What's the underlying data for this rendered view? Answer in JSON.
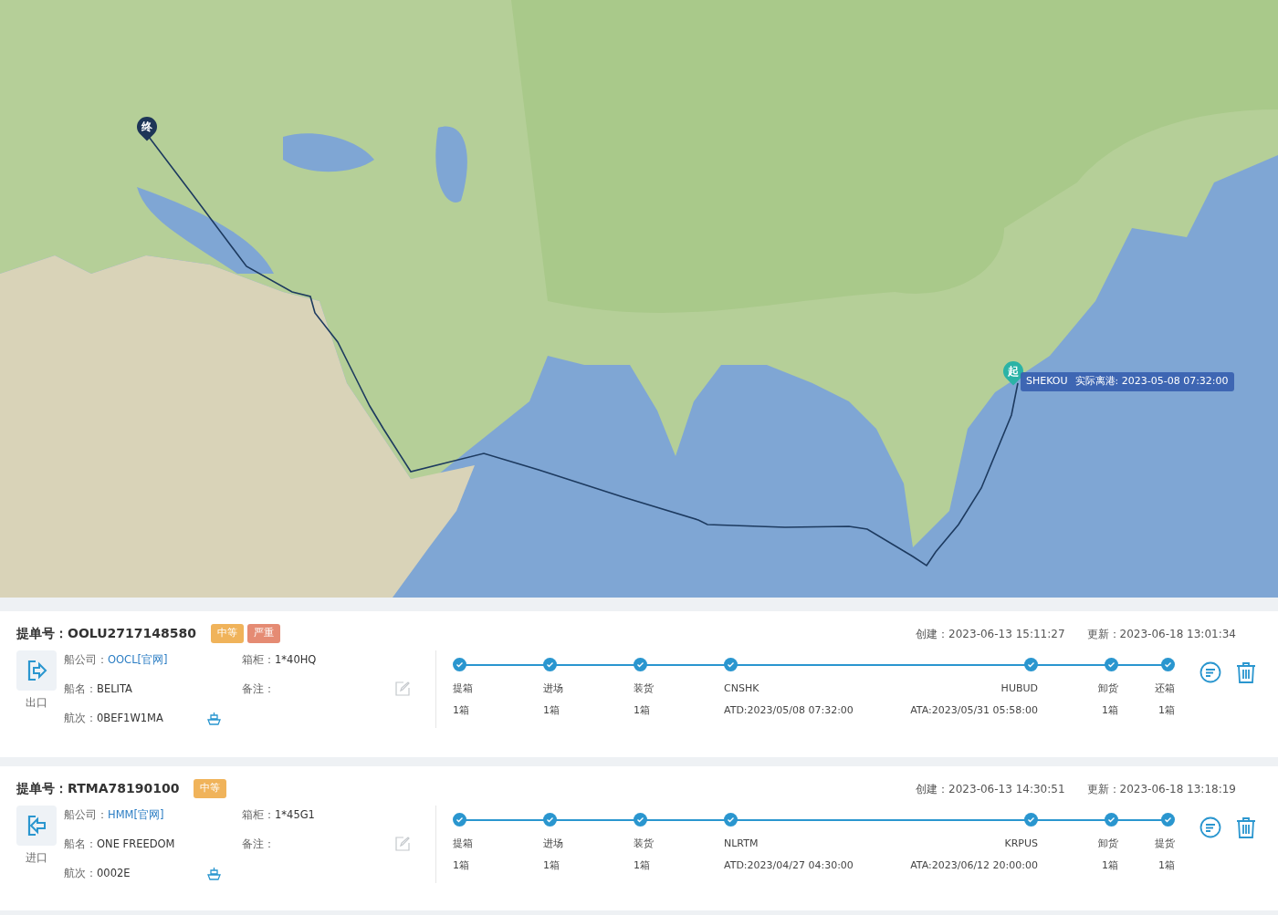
{
  "map": {
    "start_marker": "起",
    "end_marker": "终",
    "tooltip": {
      "port": "SHEKOU",
      "text": "实际离港: 2023-05-08 07:32:00"
    }
  },
  "shipments": [
    {
      "bl_label": "提单号：",
      "bl": "OOLU2717148580",
      "badges": [
        {
          "label": "中等",
          "color": "#f0b35a"
        },
        {
          "label": "严重",
          "color": "#e58b73"
        }
      ],
      "created_label": "创建：",
      "created": "2023-06-13 15:11:27",
      "updated_label": "更新：",
      "updated": "2023-06-18 13:01:34",
      "direction": {
        "kind": "export",
        "label": "出口"
      },
      "carrier_label": "船公司：",
      "carrier": "OOCL[官网]",
      "container_label": "箱柜：",
      "container": "1*40HQ",
      "vessel_label": "船名：",
      "vessel": "BELITA",
      "remark_label": "备注：",
      "voyage_label": "航次：",
      "voyage": "0BEF1W1MA",
      "steps": [
        {
          "label": "提箱",
          "value": "1箱",
          "done": true
        },
        {
          "label": "进场",
          "value": "1箱",
          "done": true
        },
        {
          "label": "装货",
          "value": "1箱",
          "done": true
        },
        {
          "label": "CNSHK",
          "value": "ATD:2023/05/08 07:32:00",
          "done": true
        },
        {
          "label": "HUBUD",
          "value": "ATA:2023/05/31 05:58:00",
          "done": true
        },
        {
          "label": "卸货",
          "value": "1箱",
          "done": true
        },
        {
          "label": "还箱",
          "value": "1箱",
          "done": true
        }
      ]
    },
    {
      "bl_label": "提单号：",
      "bl": "RTMA78190100",
      "badges": [
        {
          "label": "中等",
          "color": "#f0b35a"
        }
      ],
      "created_label": "创建：",
      "created": "2023-06-13 14:30:51",
      "updated_label": "更新：",
      "updated": "2023-06-18 13:18:19",
      "direction": {
        "kind": "import",
        "label": "进口"
      },
      "carrier_label": "船公司：",
      "carrier": "HMM[官网]",
      "container_label": "箱柜：",
      "container": "1*45G1",
      "vessel_label": "船名：",
      "vessel": "ONE FREEDOM",
      "remark_label": "备注：",
      "voyage_label": "航次：",
      "voyage": "0002E",
      "steps": [
        {
          "label": "提箱",
          "value": "1箱",
          "done": true
        },
        {
          "label": "进场",
          "value": "1箱",
          "done": true
        },
        {
          "label": "装货",
          "value": "1箱",
          "done": true
        },
        {
          "label": "NLRTM",
          "value": "ATD:2023/04/27 04:30:00",
          "done": true
        },
        {
          "label": "KRPUS",
          "value": "ATA:2023/06/12 20:00:00",
          "done": true
        },
        {
          "label": "卸货",
          "value": "1箱",
          "done": true
        },
        {
          "label": "提货",
          "value": "1箱",
          "done": true
        }
      ]
    }
  ]
}
